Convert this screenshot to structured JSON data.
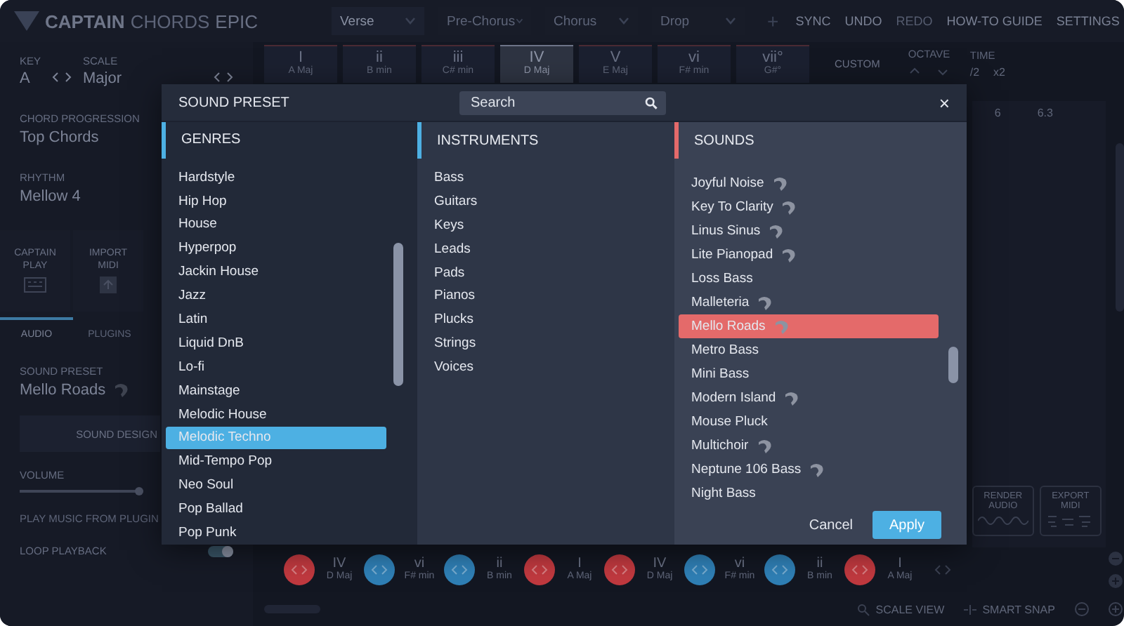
{
  "brand": {
    "name": "CAPTAIN",
    "product": "CHORDS",
    "edition": "EPIC"
  },
  "sections": [
    {
      "label": "Verse",
      "selected": true
    },
    {
      "label": "Pre-Chorus",
      "selected": false
    },
    {
      "label": "Chorus",
      "selected": false
    },
    {
      "label": "Drop",
      "selected": false
    }
  ],
  "add_section": "+",
  "menu": [
    {
      "label": "SYNC",
      "disabled": false
    },
    {
      "label": "UNDO",
      "disabled": false
    },
    {
      "label": "REDO",
      "disabled": true
    },
    {
      "label": "HOW-TO GUIDE",
      "disabled": false
    },
    {
      "label": "SETTINGS",
      "disabled": false
    }
  ],
  "key": {
    "label": "KEY",
    "value": "A"
  },
  "scale": {
    "label": "SCALE",
    "value": "Major"
  },
  "chord_buttons": [
    {
      "numeral": "I",
      "name": "A Maj",
      "selected": false
    },
    {
      "numeral": "ii",
      "name": "B min",
      "selected": false
    },
    {
      "numeral": "iii",
      "name": "C# min",
      "selected": false
    },
    {
      "numeral": "IV",
      "name": "D Maj",
      "selected": true
    },
    {
      "numeral": "V",
      "name": "E Maj",
      "selected": false
    },
    {
      "numeral": "vi",
      "name": "F# min",
      "selected": false
    },
    {
      "numeral": "vii°",
      "name": "G#°",
      "selected": false
    }
  ],
  "custom": "CUSTOM",
  "octave": {
    "label": "OCTAVE"
  },
  "time": {
    "label": "TIME",
    "options": [
      "/2",
      "x2"
    ]
  },
  "sidebar": {
    "chord_progression": {
      "label": "CHORD PROGRESSION",
      "value": "Top Chords"
    },
    "rhythm": {
      "label": "RHYTHM",
      "value": "Mellow 4"
    },
    "actions": [
      {
        "label": "CAPTAIN PLAY",
        "kind": "keyboard"
      },
      {
        "label": "IMPORT MIDI",
        "kind": "upload"
      }
    ],
    "tabs": [
      {
        "label": "AUDIO",
        "selected": true
      },
      {
        "label": "PLUGINS",
        "selected": false
      }
    ],
    "sound_preset": {
      "label": "SOUND PRESET",
      "value": "Mello Roads"
    },
    "sound_design": "SOUND DESIGN",
    "volume": {
      "label": "VOLUME",
      "level": 0.97
    },
    "play_from_plugin": "PLAY MUSIC FROM PLUGIN",
    "loop_playback": {
      "label": "LOOP PLAYBACK",
      "on": true
    }
  },
  "timeline": {
    "ticks": [
      "6",
      "6.3"
    ],
    "render": "RENDER AUDIO",
    "export": "EXPORT MIDI"
  },
  "chord_track": [
    {
      "numeral": "IV",
      "name": "D Maj",
      "color": "#c0393f"
    },
    {
      "numeral": "vi",
      "name": "F# min",
      "color": "#2f7fb5"
    },
    {
      "numeral": "ii",
      "name": "B min",
      "color": "#2f7fb5"
    },
    {
      "numeral": "I",
      "name": "A Maj",
      "color": "#c0393f"
    },
    {
      "numeral": "IV",
      "name": "D Maj",
      "color": "#c0393f"
    },
    {
      "numeral": "vi",
      "name": "F# min",
      "color": "#2f7fb5"
    },
    {
      "numeral": "ii",
      "name": "B min",
      "color": "#2f7fb5"
    },
    {
      "numeral": "I",
      "name": "A Maj",
      "color": "#c0393f"
    }
  ],
  "toolbar": {
    "scale_view": "SCALE VIEW",
    "smart_snap": "SMART SNAP"
  },
  "dialog": {
    "title": "SOUND PRESET",
    "search": {
      "placeholder": "Search"
    },
    "close": "×",
    "genres": {
      "title": "GENRES",
      "items": [
        {
          "label": "Hardstyle",
          "selected": false
        },
        {
          "label": "Hip Hop",
          "selected": false
        },
        {
          "label": "House",
          "selected": false
        },
        {
          "label": "Hyperpop",
          "selected": false
        },
        {
          "label": "Jackin House",
          "selected": false
        },
        {
          "label": "Jazz",
          "selected": false
        },
        {
          "label": "Latin",
          "selected": false
        },
        {
          "label": "Liquid DnB",
          "selected": false
        },
        {
          "label": "Lo-fi",
          "selected": false
        },
        {
          "label": "Mainstage",
          "selected": false
        },
        {
          "label": "Melodic House",
          "selected": false
        },
        {
          "label": "Melodic Techno",
          "selected": true
        },
        {
          "label": "Mid-Tempo Pop",
          "selected": false
        },
        {
          "label": "Neo Soul",
          "selected": false
        },
        {
          "label": "Pop Ballad",
          "selected": false
        },
        {
          "label": "Pop Punk",
          "selected": false
        }
      ]
    },
    "instruments": {
      "title": "INSTRUMENTS",
      "items": [
        {
          "label": "Bass",
          "selected": false
        },
        {
          "label": "Guitars",
          "selected": false
        },
        {
          "label": "Keys",
          "selected": false
        },
        {
          "label": "Leads",
          "selected": false
        },
        {
          "label": "Pads",
          "selected": false
        },
        {
          "label": "Pianos",
          "selected": false
        },
        {
          "label": "Plucks",
          "selected": false
        },
        {
          "label": "Strings",
          "selected": false
        },
        {
          "label": "Voices",
          "selected": false
        }
      ]
    },
    "sounds": {
      "title": "SOUNDS",
      "items": [
        {
          "label": "Joyful Noise",
          "selected": false,
          "badge": true
        },
        {
          "label": "Key To Clarity",
          "selected": false,
          "badge": true
        },
        {
          "label": "Linus Sinus",
          "selected": false,
          "badge": true
        },
        {
          "label": "Lite Pianopad",
          "selected": false,
          "badge": true
        },
        {
          "label": "Loss Bass",
          "selected": false,
          "badge": false
        },
        {
          "label": "Malleteria",
          "selected": false,
          "badge": true
        },
        {
          "label": "Mello Roads",
          "selected": true,
          "badge": true
        },
        {
          "label": "Metro Bass",
          "selected": false,
          "badge": false
        },
        {
          "label": "Mini Bass",
          "selected": false,
          "badge": false
        },
        {
          "label": "Modern Island",
          "selected": false,
          "badge": true
        },
        {
          "label": "Mouse Pluck",
          "selected": false,
          "badge": false
        },
        {
          "label": "Multichoir",
          "selected": false,
          "badge": true
        },
        {
          "label": "Neptune 106 Bass",
          "selected": false,
          "badge": true
        },
        {
          "label": "Night Bass",
          "selected": false,
          "badge": false
        }
      ]
    },
    "buttons": [
      {
        "label": "Cancel",
        "kind": "secondary"
      },
      {
        "label": "Apply",
        "kind": "primary"
      }
    ]
  }
}
